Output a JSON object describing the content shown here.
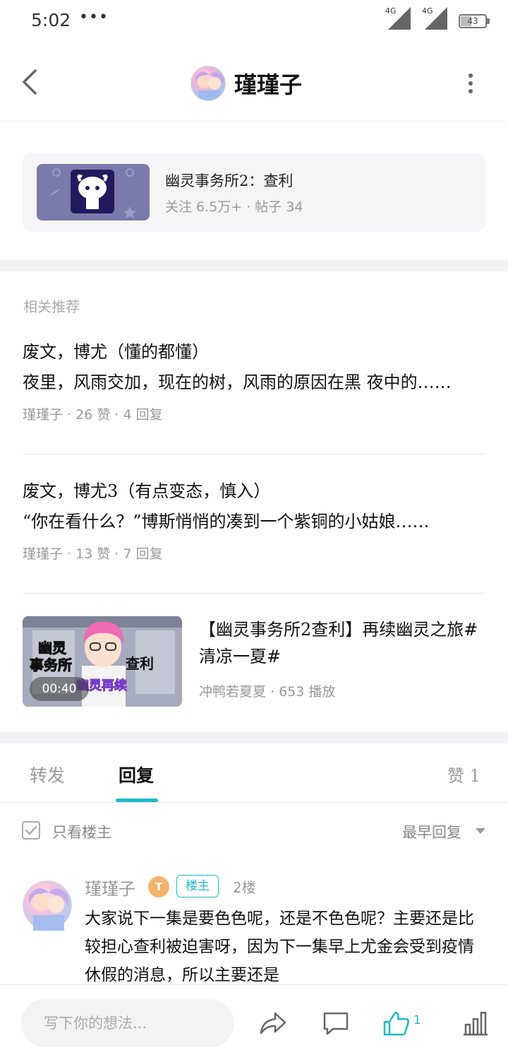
{
  "status_bar": {
    "time": "5:02",
    "dots": "•••",
    "signal_1": "4G",
    "signal_2": "4G",
    "battery": "43"
  },
  "header": {
    "name": "瑾瑾子"
  },
  "forum": {
    "title": "幽灵事务所2：查利",
    "meta": "关注 6.5万+  ·  帖子 34"
  },
  "recommendations": {
    "header": "相关推荐",
    "items": [
      {
        "title": "废文，博尤（懂的都懂）",
        "excerpt": "夜里，风雨交加，现在的树，风雨的原因在黑 夜中的……",
        "meta": "瑾瑾子  ·  26 赞  ·  4 回复"
      },
      {
        "title": "废文，博尤3（有点变态，慎入）",
        "excerpt": "“你在看什么？”博斯悄悄的凑到一个紫铜的小姑娘……",
        "meta": "瑾瑾子  ·  13 赞  ·  7 回复"
      }
    ],
    "video": {
      "title": "【幽灵事务所2查利】再续幽灵之旅#清凉一夏#",
      "duration": "00:40",
      "meta": "冲鸭若夏夏  ·  653 播放"
    }
  },
  "tabs": {
    "forward": "转发",
    "reply": "回复",
    "likes": "赞 1"
  },
  "filter": {
    "only_owner": "只看楼主",
    "sort": "最早回复"
  },
  "comment": {
    "name": "瑾瑾子",
    "level": "T",
    "owner_badge": "楼主",
    "floor": "2楼",
    "body": "大家说下一集是要色色呢，还是不色色呢？主要还是比较担心查利被迫害呀，因为下一集早上尤金会受到疫情休假的消息，所以主要还是"
  },
  "bottom_bar": {
    "input_placeholder": "写下你的想法...",
    "like_count": "1"
  },
  "colors": {
    "accent": "#1cb9c8",
    "muted": "#999999"
  }
}
